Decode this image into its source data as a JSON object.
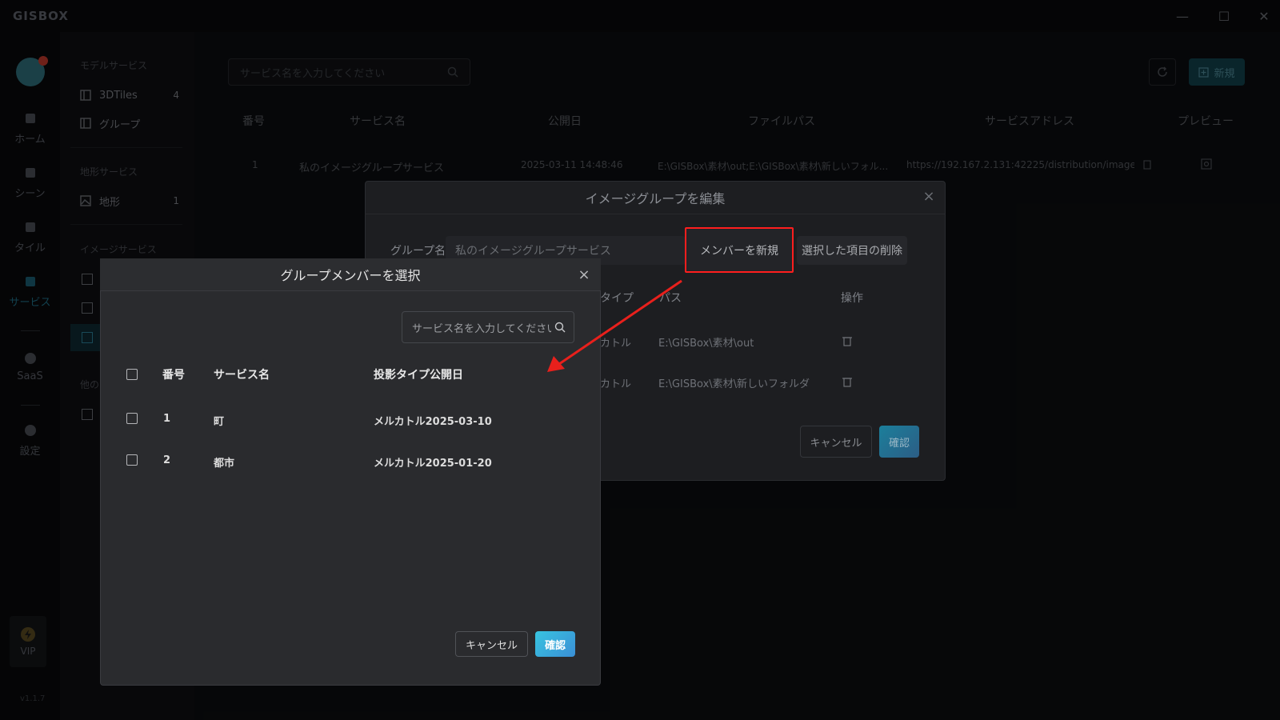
{
  "app": {
    "logo": "GISBOX"
  },
  "window_controls": {
    "minimize": "—",
    "maximize": "☐",
    "close": "✕"
  },
  "rail": {
    "items": [
      {
        "label": "ホーム",
        "icon": "home-icon"
      },
      {
        "label": "シーン",
        "icon": "scene-icon"
      },
      {
        "label": "タイル",
        "icon": "tile-icon"
      },
      {
        "label": "サービス",
        "icon": "service-icon",
        "active": true
      },
      {
        "label": "SaaS",
        "icon": "lock-icon"
      },
      {
        "label": "設定",
        "icon": "gear-icon"
      }
    ],
    "vip": "VIP",
    "version": "v1.1.7"
  },
  "sidebar": {
    "model_header": "モデルサービス",
    "model_items": [
      {
        "label": "3DTiles",
        "count": "4"
      },
      {
        "label": "グループ",
        "count": ""
      }
    ],
    "terrain_header": "地形サービス",
    "terrain_items": [
      {
        "label": "地形",
        "count": "1"
      }
    ],
    "image_header": "イメージサービス",
    "other_header": "他の"
  },
  "main": {
    "search_placeholder": "サービス名を入力してください",
    "new_button": "新規",
    "columns": [
      "番号",
      "サービス名",
      "公開日",
      "ファイルパス",
      "サービスアドレス",
      "プレビュー"
    ],
    "rows": [
      {
        "no": "1",
        "name": "私のイメージグループサービス",
        "date": "2025-03-11 14:48:46",
        "path": "E:\\GISBox\\素材\\out;E:\\GISBox\\素材\\新しいフォル...",
        "address": "https://192.167.2.131:42225/distribution/image/w..."
      }
    ]
  },
  "edit_dialog": {
    "title": "イメージグループを編集",
    "group_label": "グループ名",
    "group_value": "私のイメージグループサービス",
    "add_member_button": "メンバーを新規",
    "delete_selected_button": "選択した項目の削除",
    "columns": [
      "タイプ",
      "パス",
      "操作"
    ],
    "rows": [
      {
        "type": "カトル",
        "path": "E:\\GISBox\\素材\\out"
      },
      {
        "type": "カトル",
        "path": "E:\\GISBox\\素材\\新しいフォルダ"
      }
    ],
    "cancel": "キャンセル",
    "confirm": "確認"
  },
  "select_dialog": {
    "title": "グループメンバーを選択",
    "search_placeholder": "サービス名を入力してください",
    "columns": [
      "番号",
      "サービス名",
      "投影タイプ公開日"
    ],
    "rows": [
      {
        "no": "1",
        "name": "町",
        "proj_date": "メルカトル2025-03-10"
      },
      {
        "no": "2",
        "name": "都市",
        "proj_date": "メルカトル2025-01-20"
      }
    ],
    "cancel": "キャンセル",
    "confirm": "確認"
  },
  "colors": {
    "highlight": "#ff1e1e",
    "accent": "#38c4e0",
    "dialog_bg": "#2a2b2e"
  }
}
